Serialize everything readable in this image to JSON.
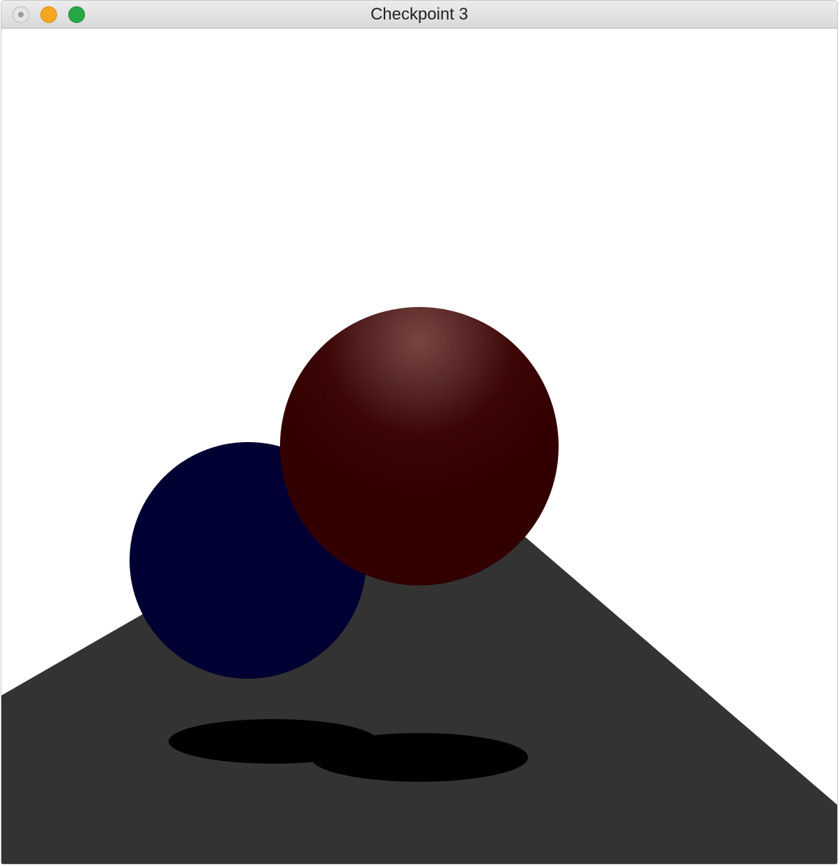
{
  "window": {
    "title": "Checkpoint 3"
  },
  "scene": {
    "background_color": "#ffffff",
    "floor_color": "#333333",
    "shadow_color": "#000000",
    "blue_sphere_color": "#000033",
    "red_sphere_color": "#330000",
    "red_sphere_highlight_color": "#7a4542"
  }
}
